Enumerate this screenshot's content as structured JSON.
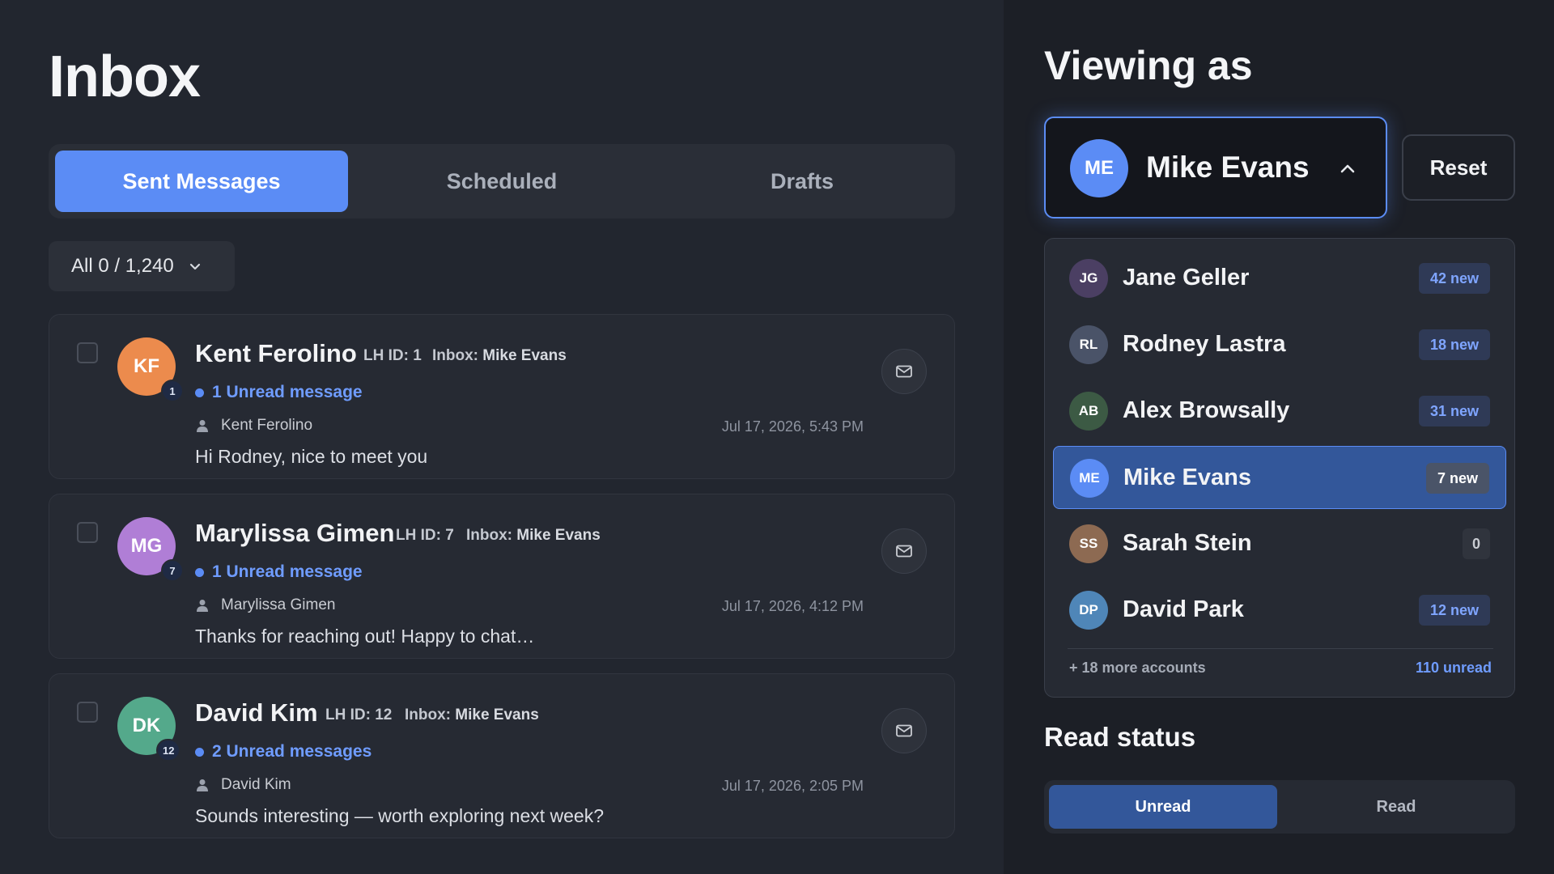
{
  "inbox": {
    "title": "Inbox",
    "tabs": [
      {
        "label": "Sent Messages",
        "active": true
      },
      {
        "label": "Scheduled",
        "active": false
      },
      {
        "label": "Drafts",
        "active": false
      }
    ],
    "filter": {
      "label": "All 0 / 1,240",
      "icon": "chevron-down-icon"
    },
    "messages": [
      {
        "initials": "KF",
        "avatar_color": "#ec8b4d",
        "badge": "1",
        "name": "Kent Ferolino",
        "lh_id_label": "LH ID:",
        "lh_id": "1",
        "inbox_label": "Inbox:",
        "inbox_value": "Mike Evans",
        "unread": "1 Unread message",
        "sender": "Kent Ferolino",
        "timestamp": "Jul 17, 2026, 5:43 PM",
        "preview": "Hi Rodney, nice to meet you"
      },
      {
        "initials": "MG",
        "avatar_color": "#b07ed6",
        "badge": "7",
        "name": "Marylissa Gimen",
        "lh_id_label": "LH ID:",
        "lh_id": "7",
        "inbox_label": "Inbox:",
        "inbox_value": "Mike Evans",
        "unread": "1 Unread message",
        "sender": "Marylissa Gimen",
        "timestamp": "Jul 17, 2026, 4:12 PM",
        "preview": "Thanks for reaching out! Happy to chat…"
      },
      {
        "initials": "DK",
        "avatar_color": "#54a98b",
        "badge": "12",
        "name": "David Kim",
        "lh_id_label": "LH ID:",
        "lh_id": "12",
        "inbox_label": "Inbox:",
        "inbox_value": "Mike Evans",
        "unread": "2 Unread messages",
        "sender": "David Kim",
        "timestamp": "Jul 17, 2026, 2:05 PM",
        "preview": "Sounds interesting — worth exploring next week?"
      }
    ]
  },
  "viewing": {
    "title": "Viewing as",
    "selected": {
      "initials": "ME",
      "name": "Mike Evans",
      "icon": "chevron-up-icon"
    },
    "reset_label": "Reset",
    "accounts": [
      {
        "initials": "JG",
        "name": "Jane Geller",
        "badge": "42 new",
        "color": "#4b3f63",
        "selected": false
      },
      {
        "initials": "RL",
        "name": "Rodney Lastra",
        "badge": "18 new",
        "color": "#4a5368",
        "selected": false
      },
      {
        "initials": "AB",
        "name": "Alex Browsally",
        "badge": "31 new",
        "color": "#3c5a44",
        "selected": false
      },
      {
        "initials": "ME",
        "name": "Mike Evans",
        "badge": "7 new",
        "color": "#5b8cf5",
        "selected": true
      },
      {
        "initials": "SS",
        "name": "Sarah Stein",
        "badge": "0",
        "color": "#8d6a52",
        "selected": false
      },
      {
        "initials": "DP",
        "name": "David Park",
        "badge": "12 new",
        "color": "#4f86b8",
        "selected": false
      }
    ],
    "more_accounts": "+ 18 more accounts",
    "total_unread": "110 unread"
  },
  "read_status": {
    "title": "Read status",
    "options": [
      {
        "label": "Unread",
        "active": true
      },
      {
        "label": "Read",
        "active": false
      }
    ]
  },
  "colors": {
    "accent": "#5b8cf5",
    "selected_bg": "#33579a",
    "link": "#6f9cff"
  }
}
